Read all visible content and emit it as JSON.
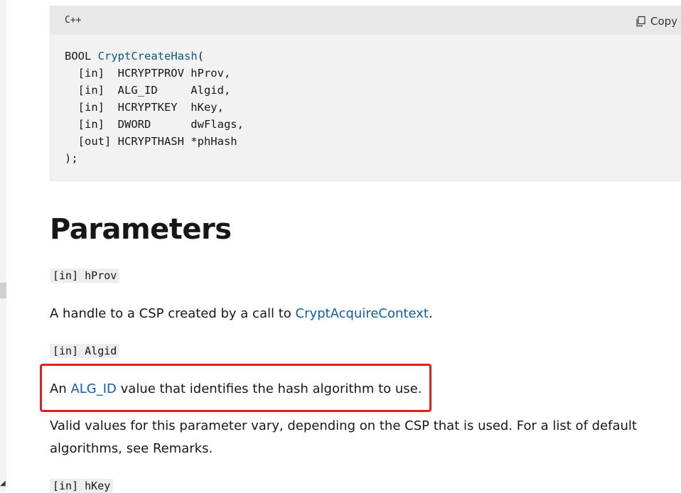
{
  "code_block": {
    "language": "C++",
    "copy_label": "Copy",
    "lines": {
      "l1_type": "BOOL ",
      "l1_fn": "CryptCreateHash",
      "l1_paren": "(",
      "l2": "  [in]  HCRYPTPROV hProv,",
      "l3": "  [in]  ALG_ID     Algid,",
      "l4": "  [in]  HCRYPTKEY  hKey,",
      "l5": "  [in]  DWORD      dwFlags,",
      "l6": "  [out] HCRYPTHASH *phHash",
      "l7": ");"
    }
  },
  "section_heading": "Parameters",
  "params": {
    "hprov": {
      "label": "[in] hProv",
      "desc_prefix": "A handle to a CSP created by a call to ",
      "desc_link": "CryptAcquireContext",
      "desc_suffix": "."
    },
    "algid": {
      "label": "[in] Algid",
      "desc_prefix": "An ",
      "desc_link": "ALG_ID",
      "desc_suffix": " value that identifies the hash algorithm to use.",
      "desc2": "Valid values for this parameter vary, depending on the CSP that is used. For a list of default algorithms, see Remarks."
    },
    "hkey": {
      "label": "[in] hKey"
    }
  },
  "colors": {
    "link": "#0f5fa6",
    "function_name": "#0e5a79",
    "highlight_box": "#e81c1c"
  },
  "icons": {
    "copy": "copy-icon"
  }
}
